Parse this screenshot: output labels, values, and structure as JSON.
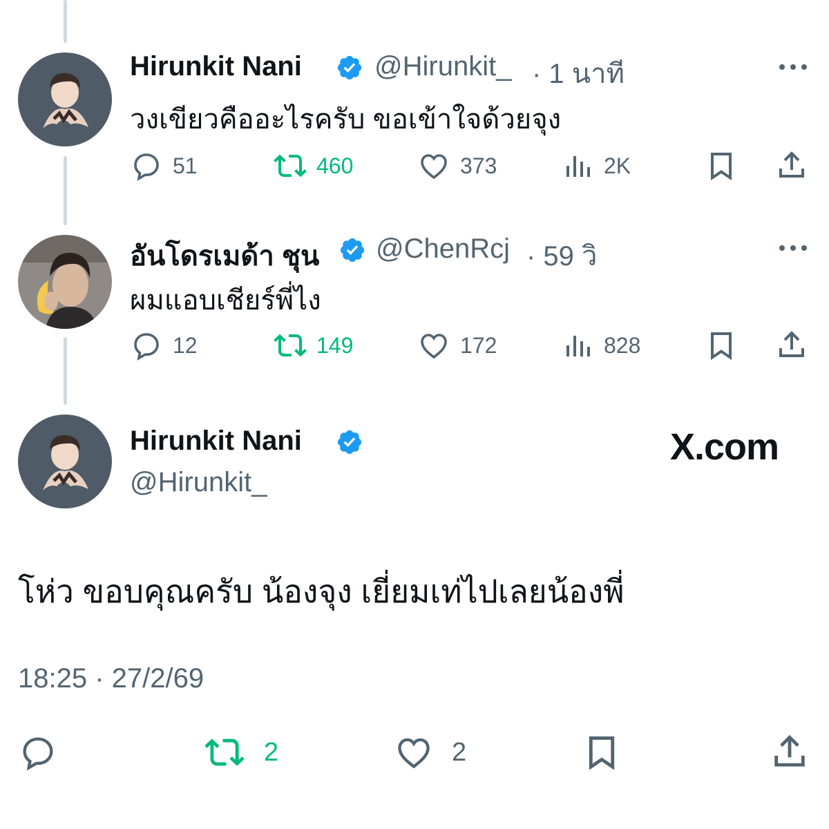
{
  "tweets": [
    {
      "name": "Hirunkit Nani",
      "handle": "@Hirunkit_",
      "time": "· 1 นาที",
      "text": "วงเขียวคืออะไรครับ ขอเข้าใจด้วยจุง",
      "replies": "51",
      "retweets": "460",
      "likes": "373",
      "views": "2K"
    },
    {
      "name": "อันโดรเมด้า ชุน",
      "handle": "@ChenRcj",
      "time": "· 59 วิ",
      "text": "ผมแอบเชียร์พี่ไง",
      "replies": "12",
      "retweets": "149",
      "likes": "172",
      "views": "828"
    }
  ],
  "main": {
    "name": "Hirunkit Nani",
    "handle": "@Hirunkit_",
    "watermark": "X.com",
    "text": "โห่ว ขอบคุณครับ น้องจุง เยี่ยมเท่ไปเลยน้องพี่",
    "timestamp": "18:25 · 27/2/69",
    "retweets": "2",
    "likes": "2"
  },
  "colors": {
    "retweet_green": "#00ba7c",
    "verified_blue": "#1d9bf0",
    "muted": "#536471"
  }
}
